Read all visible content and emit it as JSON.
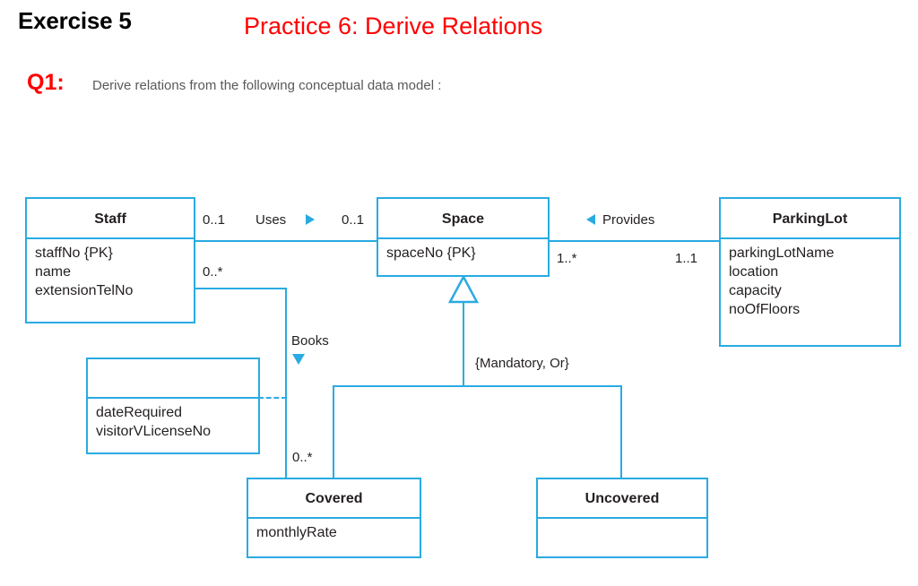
{
  "header": {
    "exercise_title": "Exercise 5",
    "practice_title": "Practice 6: Derive Relations",
    "question_label": "Q1:",
    "question_text": "Derive relations from the following conceptual data model :",
    "accent_color": "#ff0000",
    "diagram_color": "#29ABE2"
  },
  "diagram": {
    "type": "uml-class-diagram",
    "classes": [
      {
        "id": "staff",
        "name": "Staff",
        "attributes": [
          "staffNo {PK}",
          "name",
          "extensionTelNo"
        ]
      },
      {
        "id": "space",
        "name": "Space",
        "attributes": [
          "spaceNo {PK}"
        ]
      },
      {
        "id": "parkinglot",
        "name": "ParkingLot",
        "attributes": [
          "parkingLotName",
          "location",
          "capacity",
          "noOfFloors"
        ]
      },
      {
        "id": "association-class",
        "name": "",
        "attributes": [
          "dateRequired",
          "visitorVLicenseNo"
        ]
      },
      {
        "id": "covered",
        "name": "Covered",
        "attributes": [
          "monthlyRate"
        ]
      },
      {
        "id": "uncovered",
        "name": "Uncovered",
        "attributes": []
      }
    ],
    "associations": [
      {
        "id": "uses",
        "label": "Uses",
        "direction_marker": "▶",
        "source": "Staff",
        "target": "Space",
        "source_multiplicity": "0..1",
        "target_multiplicity": "0..1"
      },
      {
        "id": "provides",
        "label": "Provides",
        "direction_marker": "◀",
        "source": "Space",
        "target": "ParkingLot",
        "source_multiplicity": "1..*",
        "target_multiplicity": "1..1"
      },
      {
        "id": "books",
        "label": "Books",
        "direction_marker": "▼",
        "source": "Staff",
        "target": "Covered",
        "source_multiplicity": "0..*",
        "target_multiplicity": "0..*"
      }
    ],
    "generalization": {
      "superclass": "Space",
      "subclasses": [
        "Covered",
        "Uncovered"
      ],
      "constraint": "{Mandatory, Or}"
    },
    "multiplicities": {
      "staff_uses_left": "0..1",
      "space_uses_right": "0..1",
      "space_provides_left": "1..*",
      "parkinglot_provides_right": "1..1",
      "staff_books": "0..*",
      "covered_books": "0..*"
    }
  }
}
